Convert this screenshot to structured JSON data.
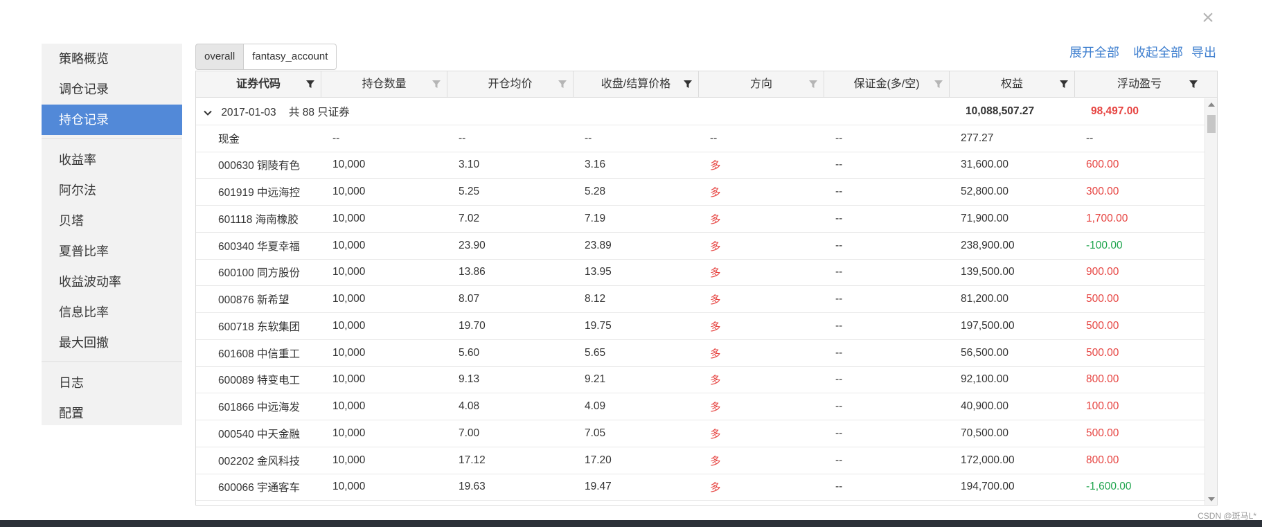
{
  "sidebar": {
    "items": [
      {
        "label": "策略概览",
        "active": false
      },
      {
        "label": "调仓记录",
        "active": false
      },
      {
        "label": "持仓记录",
        "active": true
      },
      {
        "label": "收益率",
        "active": false
      },
      {
        "label": "阿尔法",
        "active": false
      },
      {
        "label": "贝塔",
        "active": false
      },
      {
        "label": "夏普比率",
        "active": false
      },
      {
        "label": "收益波动率",
        "active": false
      },
      {
        "label": "信息比率",
        "active": false
      },
      {
        "label": "最大回撤",
        "active": false
      },
      {
        "label": "日志",
        "active": false
      },
      {
        "label": "配置",
        "active": false
      }
    ]
  },
  "tabs": [
    "overall",
    "fantasy_account"
  ],
  "actions": {
    "expand_all": "展开全部",
    "collapse_all": "收起全部",
    "export": "导出"
  },
  "close_glyph": "×",
  "columns": [
    "证券代码",
    "持仓数量",
    "开仓均价",
    "收盘/结算价格",
    "方向",
    "保证金(多/空)",
    "权益",
    "浮动盈亏"
  ],
  "group": {
    "date": "2017-01-03",
    "summary": "共 88 只证券",
    "equity": "10,088,507.27",
    "pnl": "98,497.00"
  },
  "rows": [
    {
      "code": "现金",
      "qty": "--",
      "open": "--",
      "close": "--",
      "dir": "--",
      "margin": "--",
      "equity": "277.27",
      "pnl": "--",
      "pnl_color": "neutral"
    },
    {
      "code": "000630 铜陵有色",
      "qty": "10,000",
      "open": "3.10",
      "close": "3.16",
      "dir": "多",
      "margin": "--",
      "equity": "31,600.00",
      "pnl": "600.00",
      "pnl_color": "red"
    },
    {
      "code": "601919 中远海控",
      "qty": "10,000",
      "open": "5.25",
      "close": "5.28",
      "dir": "多",
      "margin": "--",
      "equity": "52,800.00",
      "pnl": "300.00",
      "pnl_color": "red"
    },
    {
      "code": "601118 海南橡胶",
      "qty": "10,000",
      "open": "7.02",
      "close": "7.19",
      "dir": "多",
      "margin": "--",
      "equity": "71,900.00",
      "pnl": "1,700.00",
      "pnl_color": "red"
    },
    {
      "code": "600340 华夏幸福",
      "qty": "10,000",
      "open": "23.90",
      "close": "23.89",
      "dir": "多",
      "margin": "--",
      "equity": "238,900.00",
      "pnl": "-100.00",
      "pnl_color": "green"
    },
    {
      "code": "600100 同方股份",
      "qty": "10,000",
      "open": "13.86",
      "close": "13.95",
      "dir": "多",
      "margin": "--",
      "equity": "139,500.00",
      "pnl": "900.00",
      "pnl_color": "red"
    },
    {
      "code": "000876 新希望",
      "qty": "10,000",
      "open": "8.07",
      "close": "8.12",
      "dir": "多",
      "margin": "--",
      "equity": "81,200.00",
      "pnl": "500.00",
      "pnl_color": "red"
    },
    {
      "code": "600718 东软集团",
      "qty": "10,000",
      "open": "19.70",
      "close": "19.75",
      "dir": "多",
      "margin": "--",
      "equity": "197,500.00",
      "pnl": "500.00",
      "pnl_color": "red"
    },
    {
      "code": "601608 中信重工",
      "qty": "10,000",
      "open": "5.60",
      "close": "5.65",
      "dir": "多",
      "margin": "--",
      "equity": "56,500.00",
      "pnl": "500.00",
      "pnl_color": "red"
    },
    {
      "code": "600089 特变电工",
      "qty": "10,000",
      "open": "9.13",
      "close": "9.21",
      "dir": "多",
      "margin": "--",
      "equity": "92,100.00",
      "pnl": "800.00",
      "pnl_color": "red"
    },
    {
      "code": "601866 中远海发",
      "qty": "10,000",
      "open": "4.08",
      "close": "4.09",
      "dir": "多",
      "margin": "--",
      "equity": "40,900.00",
      "pnl": "100.00",
      "pnl_color": "red"
    },
    {
      "code": "000540 中天金融",
      "qty": "10,000",
      "open": "7.00",
      "close": "7.05",
      "dir": "多",
      "margin": "--",
      "equity": "70,500.00",
      "pnl": "500.00",
      "pnl_color": "red"
    },
    {
      "code": "002202 金风科技",
      "qty": "10,000",
      "open": "17.12",
      "close": "17.20",
      "dir": "多",
      "margin": "--",
      "equity": "172,000.00",
      "pnl": "800.00",
      "pnl_color": "red"
    },
    {
      "code": "600066 宇通客车",
      "qty": "10,000",
      "open": "19.63",
      "close": "19.47",
      "dir": "多",
      "margin": "--",
      "equity": "194,700.00",
      "pnl": "-1,600.00",
      "pnl_color": "green"
    }
  ],
  "watermark": "CSDN @斑马L*",
  "colors": {
    "accent": "#5289d8",
    "link": "#3f7fcf",
    "red": "#e64340",
    "green": "#21a54f"
  }
}
